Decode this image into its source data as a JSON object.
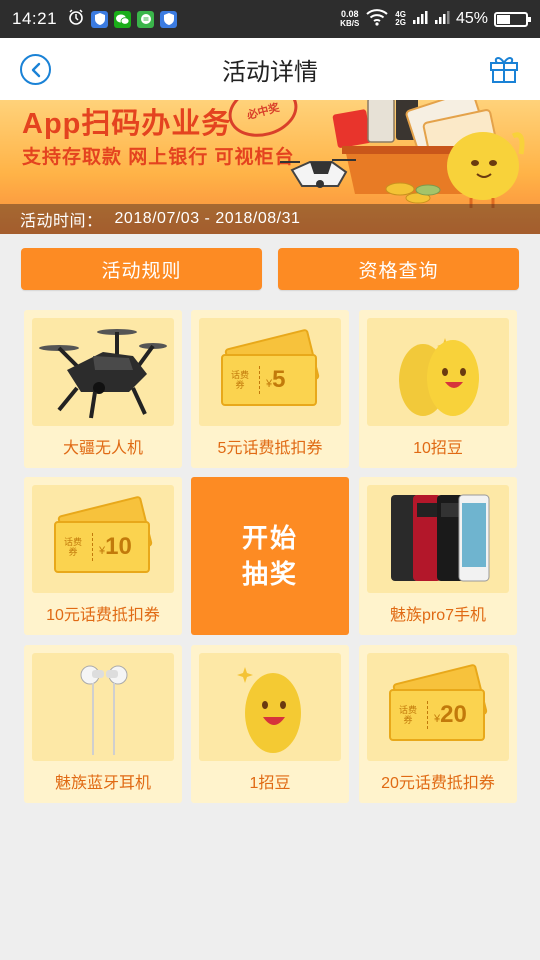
{
  "status_bar": {
    "time": "14:21",
    "speed_value": "0.08",
    "speed_unit": "KB/S",
    "net1": "4G",
    "net2": "2G",
    "battery_percent_text": "45%",
    "battery_level": 0.45
  },
  "header": {
    "title": "活动详情"
  },
  "banner": {
    "headline": "App扫码办业务",
    "subline": "支持存取款 网上银行 可视柜台",
    "stamp": "必中奖",
    "time_label": "活动时间：",
    "time_value": "2018/07/03 - 2018/08/31"
  },
  "buttons": {
    "rules": "活动规则",
    "eligibility": "资格查询"
  },
  "start": {
    "line1": "开始",
    "line2": "抽奖"
  },
  "prizes": [
    {
      "label": "大疆无人机",
      "icon": "drone-icon"
    },
    {
      "label": "5元话费抵扣券",
      "icon": "voucher-icon",
      "amount": "5",
      "tag": "话费券"
    },
    {
      "label": "10招豆",
      "icon": "beans-icon"
    },
    {
      "label": "10元话费抵扣券",
      "icon": "voucher-icon",
      "amount": "10",
      "tag": "话费券"
    },
    {
      "label": "魅族pro7手机",
      "icon": "phones-icon"
    },
    {
      "label": "魅族蓝牙耳机",
      "icon": "earphones-icon"
    },
    {
      "label": "1招豆",
      "icon": "bean-icon"
    },
    {
      "label": "20元话费抵扣券",
      "icon": "voucher-icon",
      "amount": "20",
      "tag": "话费券"
    }
  ],
  "colors": {
    "accent": "#fd8b23",
    "header_icon": "#1a82d6",
    "prize_label": "#e06a14",
    "banner_text": "#e4431f"
  }
}
